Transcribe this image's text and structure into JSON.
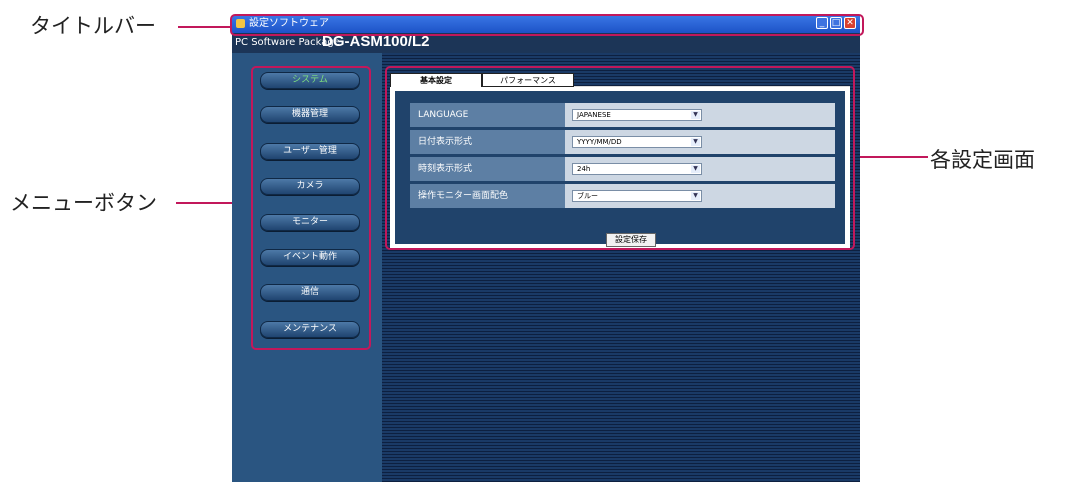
{
  "callouts": {
    "titlebar": "タイトルバー",
    "menu_buttons": "メニューボタン",
    "settings_screen": "各設定画面"
  },
  "window": {
    "title": "設定ソフトウェア",
    "brand_small": "PC Software Package",
    "brand_model": "DG-ASM100/L2"
  },
  "menu": {
    "items": [
      {
        "label": "システム"
      },
      {
        "label": "機器管理"
      },
      {
        "label": "ユーザー管理"
      },
      {
        "label": "カメラ"
      },
      {
        "label": "モニター"
      },
      {
        "label": "イベント動作"
      },
      {
        "label": "通信"
      },
      {
        "label": "メンテナンス"
      }
    ]
  },
  "tabs": [
    {
      "label": "基本設定"
    },
    {
      "label": "パフォーマンス"
    }
  ],
  "settings": {
    "rows": [
      {
        "label": "LANGUAGE",
        "value": "JAPANESE"
      },
      {
        "label": "日付表示形式",
        "value": "YYYY/MM/DD"
      },
      {
        "label": "時刻表示形式",
        "value": "24h"
      },
      {
        "label": "操作モニター画面配色",
        "value": "ブルー"
      }
    ],
    "save_label": "設定保存"
  },
  "colors": {
    "highlight": "#c2185b",
    "active_menu_text": "#7fe07f"
  }
}
